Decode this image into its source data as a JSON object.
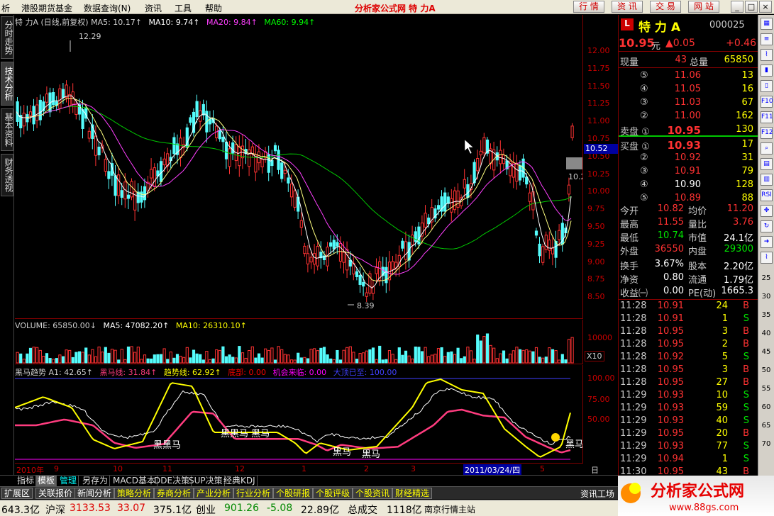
{
  "menubar": {
    "items": [
      "析",
      "港股期货基金",
      "数据查询(N)",
      "资讯",
      "工具",
      "帮助"
    ],
    "app_title": "分析家公式网 特  力A",
    "buttons": [
      "行 情",
      "资 讯",
      "交 易",
      "网 站"
    ],
    "window_controls": [
      "_",
      "□",
      "×"
    ]
  },
  "left_tabs": [
    "分时走势",
    "技术分析",
    "基本资料",
    "财务透视"
  ],
  "main_chart": {
    "legend": [
      {
        "text": "特  力A (日线,前复权) MA5: 10.17↑",
        "color": "#d0d0d0"
      },
      {
        "text": "MA10: 9.74↑",
        "color": "#ffffff"
      },
      {
        "text": "MA20: 9.84↑",
        "color": "#ff40ff"
      },
      {
        "text": "MA60: 9.94↑",
        "color": "#00ff00"
      }
    ],
    "high_label": "12.29",
    "low_label": "8.39",
    "current_price_tag": "10.52",
    "side_tag": "10.2",
    "ticks": [
      "12.00",
      "11.75",
      "11.50",
      "11.25",
      "11.00",
      "10.75",
      "10.50",
      "10.25",
      "10.00",
      "9.75",
      "9.50",
      "9.25",
      "9.00",
      "8.75",
      "8.50"
    ]
  },
  "volume_chart": {
    "legend": [
      {
        "text": "VOLUME: 65850.00↓",
        "color": "#d0d0d0"
      },
      {
        "text": "MA5: 47082.20↑",
        "color": "#ffffff"
      },
      {
        "text": "MA10: 26310.10↑",
        "color": "#ffff00"
      }
    ],
    "ticks": [
      "10000"
    ],
    "unit": "X10"
  },
  "indicator_chart": {
    "legend": [
      {
        "text": "黑马趋势  A1: 42.65↑",
        "color": "#d0d0d0"
      },
      {
        "text": "黑马线: 31.84↑",
        "color": "#ff3c7f"
      },
      {
        "text": "趋势线: 62.92↑",
        "color": "#ffff00"
      },
      {
        "text": "底部: 0.00",
        "color": "#ff0000"
      },
      {
        "text": "机会来临: 0.00",
        "color": "#ff00ff"
      },
      {
        "text": "大顶已至: 100.00",
        "color": "#4040ff"
      }
    ],
    "ticks": [
      "100.00",
      "75.00",
      "50.00"
    ],
    "labels": [
      "黑黑马",
      "黑黑马 黑马",
      "黑马",
      "黑马",
      "黑马"
    ]
  },
  "period_bar": {
    "labels": [
      "2010年",
      "9",
      "10",
      "11",
      "12",
      "1",
      "2",
      "3",
      "2011/03/24/四",
      "5"
    ],
    "right": "日线"
  },
  "tabs_row1": [
    "指标",
    "模板",
    "管理",
    "另存为",
    "MACD基本",
    "DDE决策",
    "SUP决策",
    "经典KDJ"
  ],
  "tabs_row2": [
    "扩展区",
    "关联报价",
    "新闻分析",
    "策略分析",
    "券商分析",
    "产业分析",
    "行业分析",
    "个股研报",
    "个股评级",
    "个股资讯",
    "财经精选"
  ],
  "quote": {
    "badge": "L",
    "name": "特    力 A",
    "code": "000025",
    "price": "10.95",
    "price_unit": "元",
    "change": "▲0.05",
    "change_pct": "+0.46",
    "now_vol_label": "现量",
    "now_vol": "43",
    "total_vol_label": "总量",
    "total_vol": "65850",
    "asks": [
      {
        "label": "⑤",
        "price": "11.06",
        "vol": "13"
      },
      {
        "label": "④",
        "price": "11.05",
        "vol": "16"
      },
      {
        "label": "③",
        "price": "11.03",
        "vol": "67"
      },
      {
        "label": "②",
        "price": "11.00",
        "vol": "162"
      },
      {
        "label": "卖盘 ①",
        "price": "10.95",
        "vol": "130"
      }
    ],
    "bids": [
      {
        "label": "买盘 ①",
        "price": "10.93",
        "vol": "17"
      },
      {
        "label": "②",
        "price": "10.92",
        "vol": "31"
      },
      {
        "label": "③",
        "price": "10.91",
        "vol": "79"
      },
      {
        "label": "④",
        "price": "10.90",
        "vol": "128"
      },
      {
        "label": "⑤",
        "price": "10.89",
        "vol": "88"
      }
    ],
    "stats": [
      {
        "l1": "今开",
        "v1": "10.82",
        "c1": "red",
        "l2": "均价",
        "v2": "11.20",
        "c2": "red"
      },
      {
        "l1": "最高",
        "v1": "11.55",
        "c1": "red",
        "l2": "量比",
        "v2": "3.76",
        "c2": "red"
      },
      {
        "l1": "最低",
        "v1": "10.74",
        "c1": "green",
        "l2": "市值",
        "v2": "24.1亿",
        "c2": "white"
      },
      {
        "l1": "外盘",
        "v1": "36550",
        "c1": "red",
        "l2": "内盘",
        "v2": "29300",
        "c2": "green"
      }
    ],
    "stats2": [
      {
        "l1": "换手",
        "v1": "3.67%",
        "l2": "股本",
        "v2": "2.20亿"
      },
      {
        "l1": "净资",
        "v1": "0.80",
        "l2": "流通",
        "v2": "1.79亿"
      },
      {
        "l1": "收益㈠",
        "v1": "0.00",
        "l2": "PE(动)",
        "v2": "1665.3"
      }
    ],
    "trades": [
      {
        "t": "11:28",
        "p": "10.91",
        "pc": "red",
        "v": "24",
        "s": "B"
      },
      {
        "t": "11:28",
        "p": "10.91",
        "pc": "red",
        "v": "1",
        "s": "S"
      },
      {
        "t": "11:28",
        "p": "10.95",
        "pc": "red",
        "v": "3",
        "s": "B"
      },
      {
        "t": "11:28",
        "p": "10.95",
        "pc": "red",
        "v": "2",
        "s": "B"
      },
      {
        "t": "11:28",
        "p": "10.92",
        "pc": "red",
        "v": "5",
        "s": "S"
      },
      {
        "t": "11:28",
        "p": "10.95",
        "pc": "red",
        "v": "3",
        "s": "B"
      },
      {
        "t": "11:28",
        "p": "10.95",
        "pc": "red",
        "v": "27",
        "s": "B"
      },
      {
        "t": "11:29",
        "p": "10.93",
        "pc": "red",
        "v": "10",
        "s": "S"
      },
      {
        "t": "11:29",
        "p": "10.93",
        "pc": "red",
        "v": "59",
        "s": "S"
      },
      {
        "t": "11:29",
        "p": "10.93",
        "pc": "red",
        "v": "40",
        "s": "S"
      },
      {
        "t": "11:29",
        "p": "10.95",
        "pc": "red",
        "v": "20",
        "s": "B"
      },
      {
        "t": "11:29",
        "p": "10.93",
        "pc": "red",
        "v": "77",
        "s": "S"
      },
      {
        "t": "11:29",
        "p": "10.94",
        "pc": "red",
        "v": "1",
        "s": "S"
      },
      {
        "t": "11:30",
        "p": "10.95",
        "pc": "red",
        "v": "43",
        "s": "B"
      }
    ]
  },
  "right_strip_icons": [
    "grid-icon",
    "list-icon",
    "chart-icon",
    "bars-icon",
    "candles-icon",
    "f10-icon",
    "f11-icon",
    "f12-icon",
    "zoom-icon",
    "table-icon",
    "vol-icon",
    "rsi-icon",
    "move-icon",
    "refresh-icon",
    "arrow-icon",
    "chart-icon"
  ],
  "right_strip_labels": [
    "F10",
    "F11",
    "F12",
    "RSI"
  ],
  "side_numbers": [
    "25",
    "30",
    "35",
    "40",
    "45",
    "50",
    "55",
    "60",
    "65",
    "70"
  ],
  "status": {
    "i1_label": "643.3亿",
    "i2_label": "沪深",
    "i2_val": "3133.53",
    "i2_chg": "33.07",
    "i2_amt": "375.1亿",
    "i3_label": "创业",
    "i3_val": "901.26",
    "i3_chg": "-5.08",
    "i3_amt": "22.89亿",
    "i4_label": "总成交",
    "i4_val": "1118亿",
    "station": "南京行情主站",
    "tool": "资讯工场",
    "logo_text": "分析家公式网",
    "logo_url": "www.88gs.com"
  }
}
